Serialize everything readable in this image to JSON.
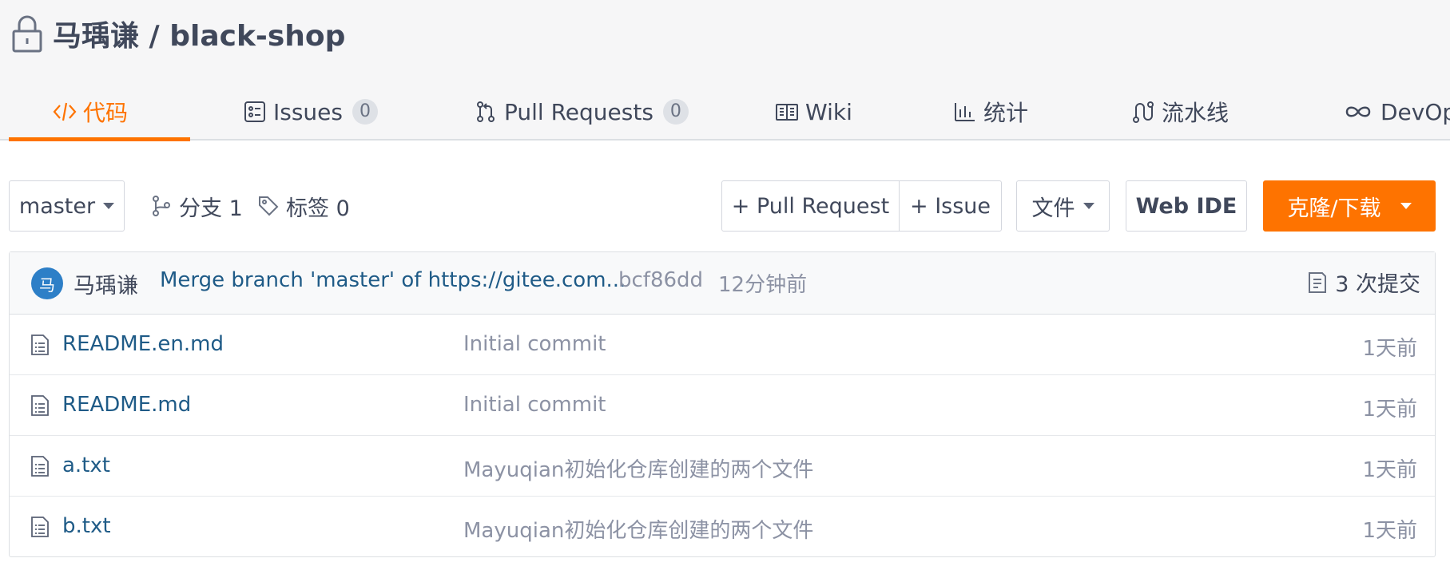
{
  "repo": {
    "title": "马瑀谦 / black-shop",
    "lock_icon": "lock-icon"
  },
  "tabs": [
    {
      "label": "代码",
      "icon": "code-icon",
      "active": true
    },
    {
      "label": "Issues",
      "icon": "issues-icon",
      "count": "0"
    },
    {
      "label": "Pull Requests",
      "icon": "pull-request-icon",
      "count": "0"
    },
    {
      "label": "Wiki",
      "icon": "book-icon"
    },
    {
      "label": "统计",
      "icon": "bar-chart-icon"
    },
    {
      "label": "流水线",
      "icon": "pipeline-icon"
    },
    {
      "label": "DevOps",
      "icon": "infinity-icon"
    }
  ],
  "toolbar": {
    "branch": "master",
    "branches": "分支 1",
    "tags": "标签 0",
    "new_pr": "+ Pull Request",
    "new_issue": "+ Issue",
    "file": "文件",
    "web_ide": "Web IDE",
    "clone": "克隆/下载"
  },
  "last_commit": {
    "avatar": "马",
    "author": "马瑀谦",
    "message": "Merge branch 'master' of https://gitee.com...",
    "hash": "bcf86dd",
    "time": "12分钟前",
    "commits": "3 次提交"
  },
  "files": [
    {
      "name": "README.en.md",
      "message": "Initial commit",
      "time": "1天前"
    },
    {
      "name": "README.md",
      "message": "Initial commit",
      "time": "1天前"
    },
    {
      "name": "a.txt",
      "message": "Mayuqian初始化仓库创建的两个文件",
      "time": "1天前"
    },
    {
      "name": "b.txt",
      "message": "Mayuqian初始化仓库创建的两个文件",
      "time": "1天前"
    }
  ],
  "colors": {
    "accent": "#fe7300",
    "link": "#1f5b87",
    "muted": "#8c92a4",
    "text": "#40485b"
  }
}
